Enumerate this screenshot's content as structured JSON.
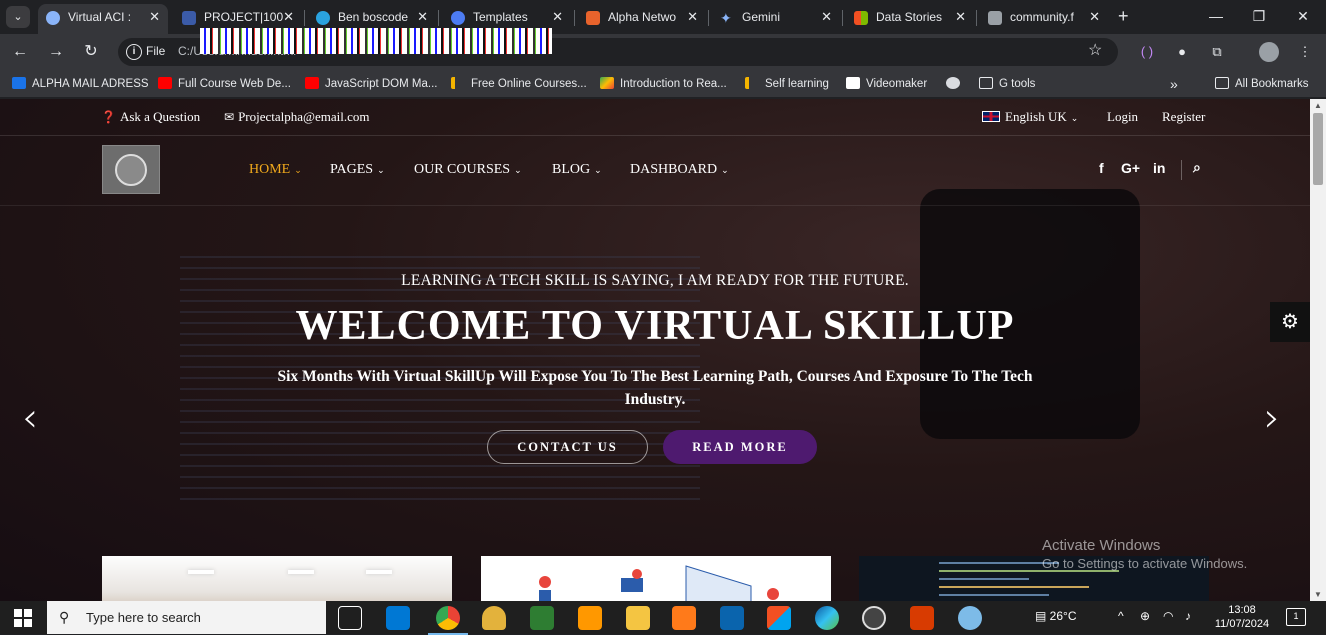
{
  "browser": {
    "tabs": [
      {
        "label": "Virtual ACI :",
        "active": true
      },
      {
        "label": "PROJECT|100"
      },
      {
        "label": "Ben boscode"
      },
      {
        "label": "Templates"
      },
      {
        "label": "Alpha Netwo"
      },
      {
        "label": "Gemini"
      },
      {
        "label": "Data Stories"
      },
      {
        "label": "community.f"
      }
    ],
    "new_tab": "+",
    "file_label": "File",
    "url_text": "C:/Users/.../index.html",
    "bookmarks": [
      {
        "label": "ALPHA MAIL ADRESS"
      },
      {
        "label": "Full Course Web De..."
      },
      {
        "label": "JavaScript DOM Ma..."
      },
      {
        "label": "Free Online Courses..."
      },
      {
        "label": "Introduction to Rea..."
      },
      {
        "label": "Self learning"
      },
      {
        "label": "Videomaker"
      },
      {
        "label": ""
      },
      {
        "label": "G tools"
      }
    ],
    "more_bookmarks": "»",
    "all_bookmarks": "All Bookmarks"
  },
  "site": {
    "topbar": {
      "ask": "Ask a Question",
      "email": "Projectalpha@email.com",
      "language": "English UK",
      "login": "Login",
      "register": "Register"
    },
    "nav": {
      "items": [
        {
          "label": "HOME"
        },
        {
          "label": "PAGES"
        },
        {
          "label": "OUR COURSES"
        },
        {
          "label": "BLOG"
        },
        {
          "label": "DASHBOARD"
        }
      ],
      "active_color": "#f1a91c",
      "social": [
        "f",
        "G+",
        "in"
      ]
    },
    "hero": {
      "kicker": "LEARNING A TECH SKILL IS SAYING, I AM READY FOR THE FUTURE.",
      "title": "WELCOME TO VIRTUAL SKILLUP",
      "subtitle": "Six Months With Virtual SkillUp Will Expose You To The Best Learning Path, Courses And Exposure To The Tech Industry.",
      "btn_contact": "CONTACT US",
      "btn_read": "READ MORE",
      "accent": "#4e1a6f"
    },
    "watermark": {
      "line1": "Activate Windows",
      "line2": "Go to Settings to activate Windows."
    }
  },
  "taskbar": {
    "search_placeholder": "Type here to search",
    "weather": "26°C",
    "time": "13:08",
    "date": "11/07/2024",
    "notifications": "1"
  }
}
